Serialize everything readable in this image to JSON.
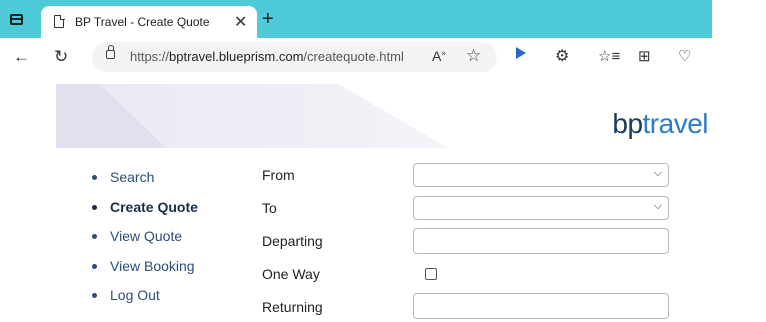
{
  "browser": {
    "tab_title": "BP Travel - Create Quote",
    "url_prefix": "https://",
    "url_host": "bptravel.blueprism.com",
    "url_path": "/createquote.html",
    "icons": [
      "window-icon",
      "page-icon",
      "close-icon",
      "new-tab-icon",
      "back-icon",
      "refresh-icon",
      "lock-icon",
      "read-aloud-icon",
      "favorite-star-icon",
      "play-icon",
      "extensions-icon",
      "favorites-icon",
      "collections-icon",
      "browser-essentials-icon"
    ]
  },
  "brand": {
    "bp": "bp",
    "travel": "travel"
  },
  "nav": {
    "items": [
      {
        "label": "Search"
      },
      {
        "label": "Create Quote"
      },
      {
        "label": "View Quote"
      },
      {
        "label": "View Booking"
      },
      {
        "label": "Log Out"
      }
    ]
  },
  "form": {
    "from_label": "From",
    "to_label": "To",
    "departing_label": "Departing",
    "one_way_label": "One Way",
    "returning_label": "Returning",
    "from_value": "",
    "to_value": "",
    "departing_value": "",
    "one_way_checked": false,
    "returning_value": ""
  },
  "colors": {
    "tabstrip": "#4ecad8",
    "nav_link": "#2c4d7a",
    "brand_travel": "#2e7cc4"
  }
}
